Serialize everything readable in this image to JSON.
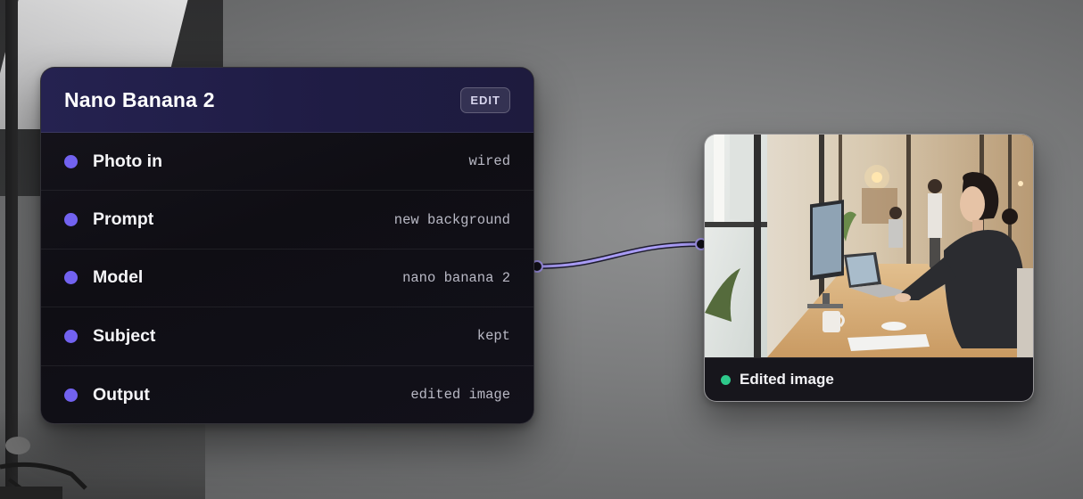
{
  "node": {
    "title": "Nano Banana 2",
    "edit_label": "EDIT",
    "accent_color": "#7262f0",
    "rows": [
      {
        "label": "Photo in",
        "value": "wired"
      },
      {
        "label": "Prompt",
        "value": "new background"
      },
      {
        "label": "Model",
        "value": "nano banana 2"
      },
      {
        "label": "Subject",
        "value": "kept"
      },
      {
        "label": "Output",
        "value": "edited image"
      }
    ]
  },
  "output": {
    "label": "Edited image",
    "status_color": "#2ec98b",
    "image_subject": "woman-at-desk-office-photo"
  },
  "connector": {
    "color": "#a99cf5"
  }
}
